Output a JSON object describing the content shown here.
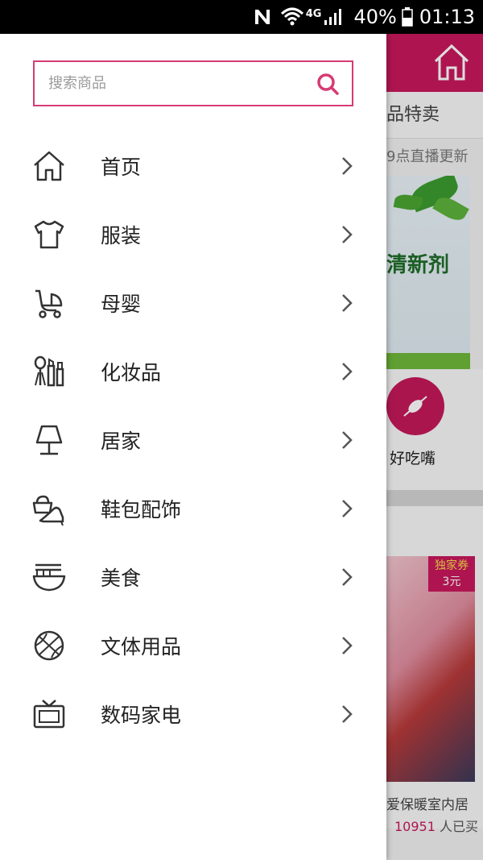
{
  "status_bar": {
    "battery": "40%",
    "time": "01:13",
    "network": "4G"
  },
  "drawer": {
    "search": {
      "placeholder": "搜索商品",
      "value": ""
    },
    "accent_color": "#d63b74",
    "menu": [
      {
        "label": "首页",
        "icon": "home-icon"
      },
      {
        "label": "服装",
        "icon": "tshirt-icon"
      },
      {
        "label": "母婴",
        "icon": "stroller-icon"
      },
      {
        "label": "化妆品",
        "icon": "cosmetics-icon"
      },
      {
        "label": "居家",
        "icon": "lamp-icon"
      },
      {
        "label": "鞋包配饰",
        "icon": "bag-shoe-icon"
      },
      {
        "label": "美食",
        "icon": "noodle-bowl-icon"
      },
      {
        "label": "文体用品",
        "icon": "basketball-icon"
      },
      {
        "label": "数码家电",
        "icon": "tv-icon"
      }
    ]
  },
  "background_app": {
    "header_color": "#c8195c",
    "subtitle": "品特卖",
    "update_note": "9点直播更新",
    "banner_text": "清新剂",
    "category_label": "好吃嘴",
    "coupon": {
      "line1": "独家券",
      "line2": "3元"
    },
    "card_title": "爱保暖室内居",
    "buyers_count": "10951",
    "buyers_suffix": "人已买"
  }
}
